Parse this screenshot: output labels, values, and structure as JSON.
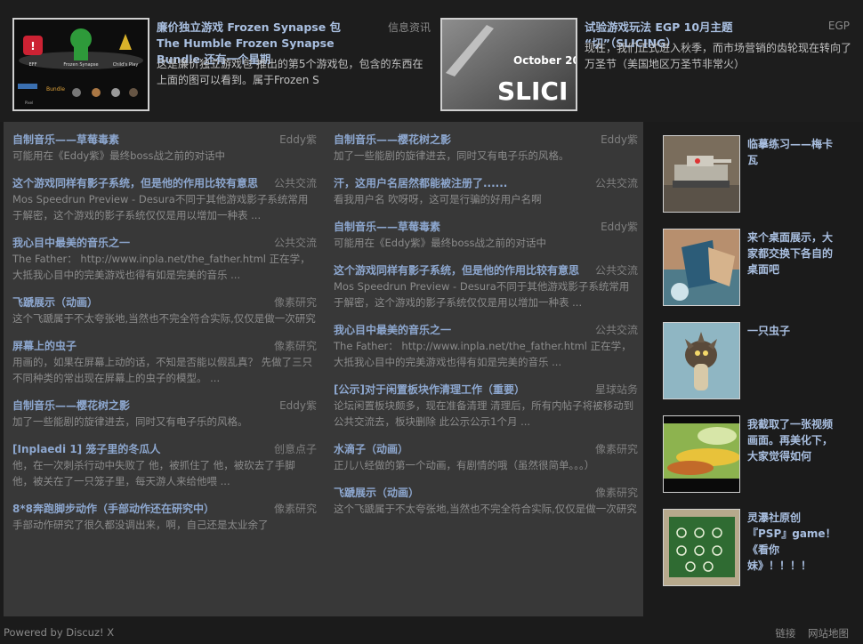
{
  "featured": [
    {
      "title": "廉价独立游戏 Frozen Synapse 包 The Humble Frozen Synapse Bundle 还有一个星期",
      "category": "信息资讯",
      "desc": "这是廉价独立游戏包 推出的第5个游戏包，包含的东西在上面的图可以看到。属于Frozen S",
      "thumb_labels": [
        "EFF",
        "Frozen Synapse",
        "Child's Play",
        "Pixel",
        "Bundle"
      ]
    },
    {
      "title": "试验游戏玩法 EGP 10月主题 “切”（SLICING）",
      "category": "EGP",
      "desc": "现在，我们正式进入秋季，而市场营销的齿轮现在转向了万圣节（美国地区万圣节非常火）",
      "thumb_text_1": "October 20",
      "thumb_text_2": "SLICI"
    }
  ],
  "left_column": [
    {
      "title": "自制音乐——草莓毒素",
      "category": "Eddy紫",
      "desc": "可能用在《Eddy紫》最终boss战之前的对话中"
    },
    {
      "title": "这个游戏同样有影子系统，但是他的作用比较有意思",
      "category": "公共交流",
      "desc": "Mos Speedrun Preview - Desura不同于其他游戏影子系统常用于解密，这个游戏的影子系统仅仅是用以增加一种表 ..."
    },
    {
      "title": "我心目中最美的音乐之一",
      "category": "公共交流",
      "desc": "The Father： http://www.inpla.net/the_father.html 正在学，大抵我心目中的完美游戏也得有如是完美的音乐 ..."
    },
    {
      "title": "飞蹏展示（动画）",
      "category": "像素研究",
      "desc": "这个飞蹏属于不太夸张地,当然也不完全符合实际,仅仅是做一次研究"
    },
    {
      "title": "屏幕上的虫子",
      "category": "像素研究",
      "desc": "用画的，如果在屏幕上动的话，不知是否能以假乱真？ 先做了三只不同种类的常出现在屏幕上的虫子的模型。 ..."
    },
    {
      "title": "自制音乐——樱花树之影",
      "category": "Eddy紫",
      "desc": "加了一些能剧的旋律进去，同时又有电子乐的风格。"
    },
    {
      "title": "[Inplaedi 1] 笼子里的冬瓜人",
      "category": "创意点子",
      "desc": "他，在一次刺杀行动中失败了 他，被抓住了 他，被砍去了手脚 他，被关在了一只笼子里，每天游人来给他喂 ..."
    },
    {
      "title": "8*8奔跑脚步动作（手部动作还在研究中）",
      "category": "像素研究",
      "desc": "手部动作研究了很久都没调出来，啊，自己还是太业余了"
    }
  ],
  "right_column": [
    {
      "title": "自制音乐——樱花树之影",
      "category": "Eddy紫",
      "desc": "加了一些能剧的旋律进去，同时又有电子乐的风格。"
    },
    {
      "title": "汗，这用户名居然都能被注册了......",
      "category": "公共交流",
      "desc": "看我用户名 吹呀呀，这可是行骗的好用户名啊"
    },
    {
      "title": "自制音乐——草莓毒素",
      "category": "Eddy紫",
      "desc": "可能用在《Eddy紫》最终boss战之前的对话中"
    },
    {
      "title": "这个游戏同样有影子系统，但是他的作用比较有意思",
      "category": "公共交流",
      "desc": "Mos Speedrun Preview - Desura不同于其他游戏影子系统常用于解密，这个游戏的影子系统仅仅是用以增加一种表 ..."
    },
    {
      "title": "我心目中最美的音乐之一",
      "category": "公共交流",
      "desc": "The Father： http://www.inpla.net/the_father.html 正在学，大抵我心目中的完美游戏也得有如是完美的音乐 ..."
    },
    {
      "title": "[公示]对于闲置板块作清理工作（重要）",
      "category": "星球站务",
      "desc": "论坛闲置板块颇多，现在准备清理 清理后，所有内帖子将被移动到公共交流去，板块删除 此公示公示1个月 ..."
    },
    {
      "title": "水滴子（动画）",
      "category": "像素研究",
      "desc": "正儿八经做的第一个动画，有剧情的哦（虽然很简单。。。）"
    },
    {
      "title": "飞蹏展示（动画）",
      "category": "像素研究",
      "desc": "这个飞蹏属于不太夸张地,当然也不完全符合实际,仅仅是做一次研究"
    }
  ],
  "sidebar": [
    {
      "title": "临摹练习——梅卡瓦",
      "thumb": "tank"
    },
    {
      "title": "来个桌面展示，大家都交换下各自的桌面吧",
      "thumb": "desktop"
    },
    {
      "title": "一只虫子",
      "thumb": "bug"
    },
    {
      "title": "我截取了一张视频画面。再美化下，大家觉得如何",
      "thumb": "video"
    },
    {
      "title": "灵瀑社原创『PSP』game！《看你妹》！！！！",
      "thumb": "psp"
    }
  ],
  "footer": {
    "powered": "Powered by Discuz! X",
    "link_1": "链接",
    "link_2": "网站地图"
  }
}
